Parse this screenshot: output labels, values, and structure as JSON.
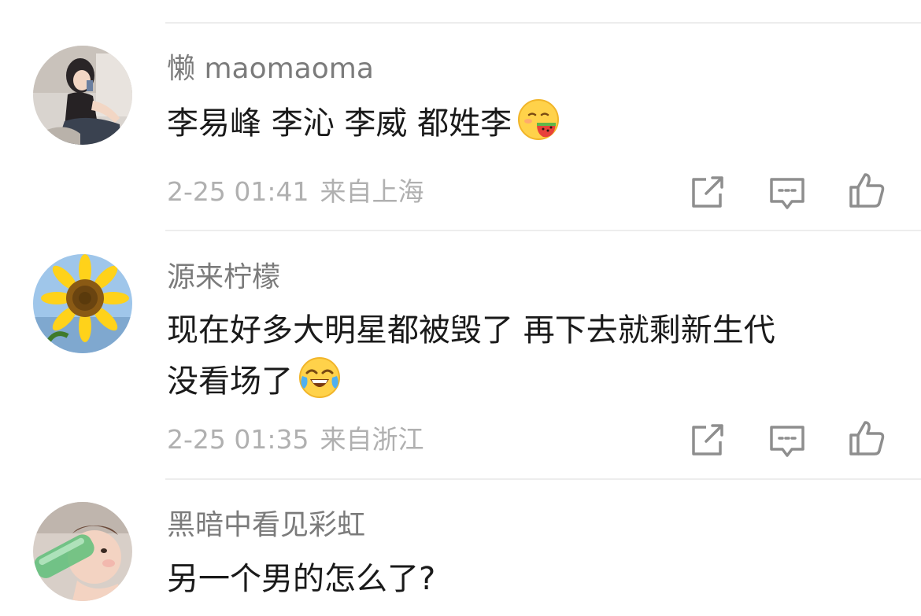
{
  "comments": [
    {
      "username": "懒 maomaoma",
      "text_lines": [
        "李易峰 李沁 李威 都姓李"
      ],
      "emoji": "watermelon-face-emoji",
      "time": "2-25 01:41",
      "location": "来自上海",
      "avatar": "girl-avatar"
    },
    {
      "username": "源来柠檬",
      "text_lines": [
        "现在好多大明星都被毁了 再下去就剩新生代",
        "没看场了"
      ],
      "emoji": "crying-laughing-emoji",
      "time": "2-25 01:35",
      "location": "来自浙江",
      "avatar": "sunflower-avatar"
    },
    {
      "username": "黑暗中看见彩虹",
      "text_lines": [
        "另一个男的怎么了?"
      ],
      "emoji": "",
      "time": "",
      "location": "",
      "avatar": "baby-bottle-avatar"
    }
  ],
  "actions": {
    "share_icon": "share-icon",
    "comment_icon": "comment-icon",
    "like_icon": "thumbs-up-icon"
  },
  "colors": {
    "username": "#7b7b7b",
    "text": "#1a1a1a",
    "meta": "#b0b0b0",
    "divider": "#ededed",
    "icon": "#8e8e8e"
  }
}
